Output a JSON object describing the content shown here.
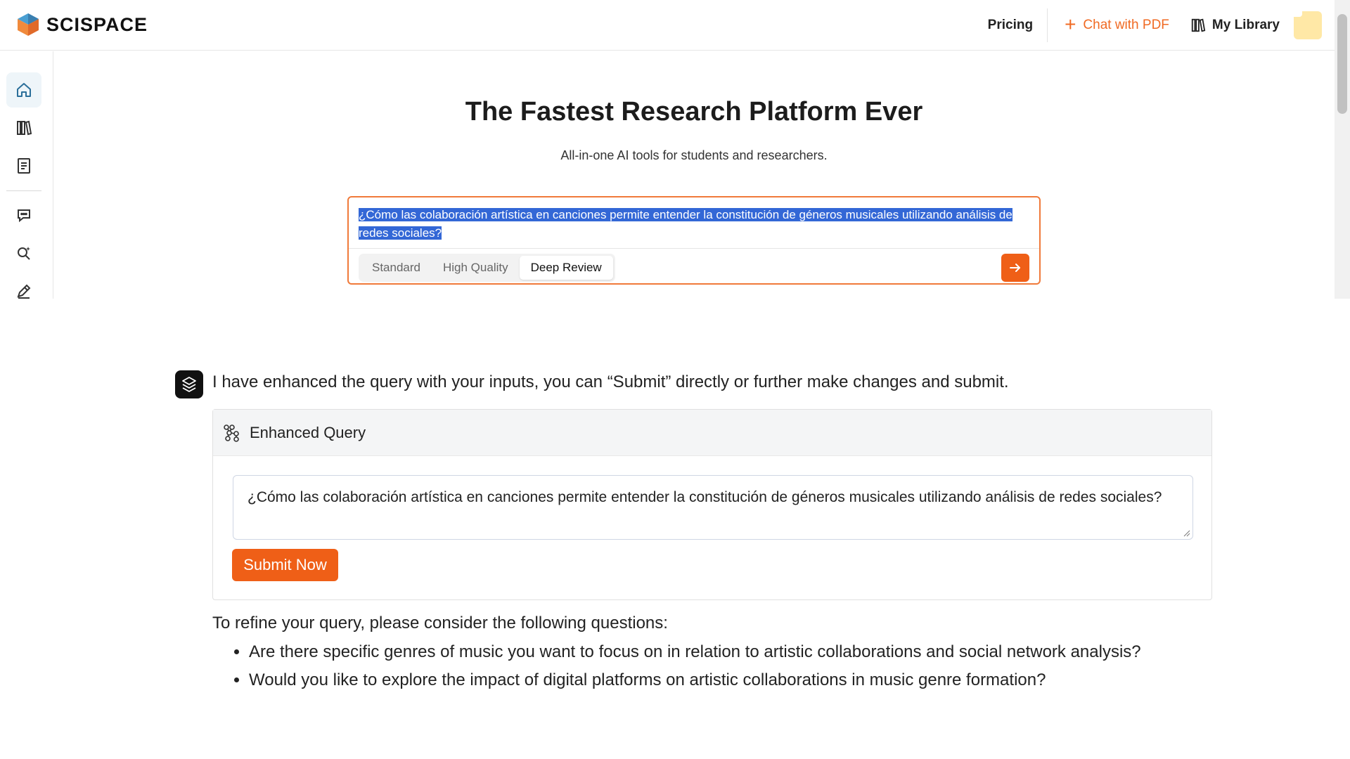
{
  "brand": {
    "name": "SCISPACE",
    "colors": {
      "accent": "#ef5f17",
      "logo_blue": "#3f8fc4",
      "logo_orange": "#f08a3c"
    }
  },
  "header": {
    "nav": {
      "pricing": "Pricing",
      "chat_with_pdf": "Chat with PDF",
      "my_library": "My Library"
    }
  },
  "sidebar": {
    "items": [
      {
        "icon": "home-icon",
        "active": true
      },
      {
        "icon": "library-icon",
        "active": false
      },
      {
        "icon": "notebook-icon",
        "active": false
      },
      {
        "icon": "chat-icon",
        "active": false
      },
      {
        "icon": "search-sparkle-icon",
        "active": false
      },
      {
        "icon": "pen-icon",
        "active": false
      }
    ]
  },
  "hero": {
    "title": "The Fastest Research Platform Ever",
    "subtitle": "All-in-one AI tools for students and researchers."
  },
  "search": {
    "query": "¿Cómo las colaboración artística en canciones permite entender la constitución de géneros musicales utilizando análisis de redes sociales?",
    "modes": [
      "Standard",
      "High Quality",
      "Deep Review"
    ],
    "selected_mode": "Deep Review"
  },
  "assistant": {
    "message": "I have enhanced the query with your inputs, you can “Submit” directly or further make changes and submit.",
    "enhanced_query": {
      "title": "Enhanced Query",
      "value": "¿Cómo las colaboración artística en canciones permite entender la constitución de géneros musicales utilizando análisis de redes sociales?",
      "submit_label": "Submit Now"
    },
    "refine": {
      "title": "To refine your query, please consider the following questions:",
      "questions": [
        "Are there specific genres of music you want to focus on in relation to artistic collaborations and social network analysis?",
        "Would you like to explore the impact of digital platforms on artistic collaborations in music genre formation?"
      ]
    }
  }
}
